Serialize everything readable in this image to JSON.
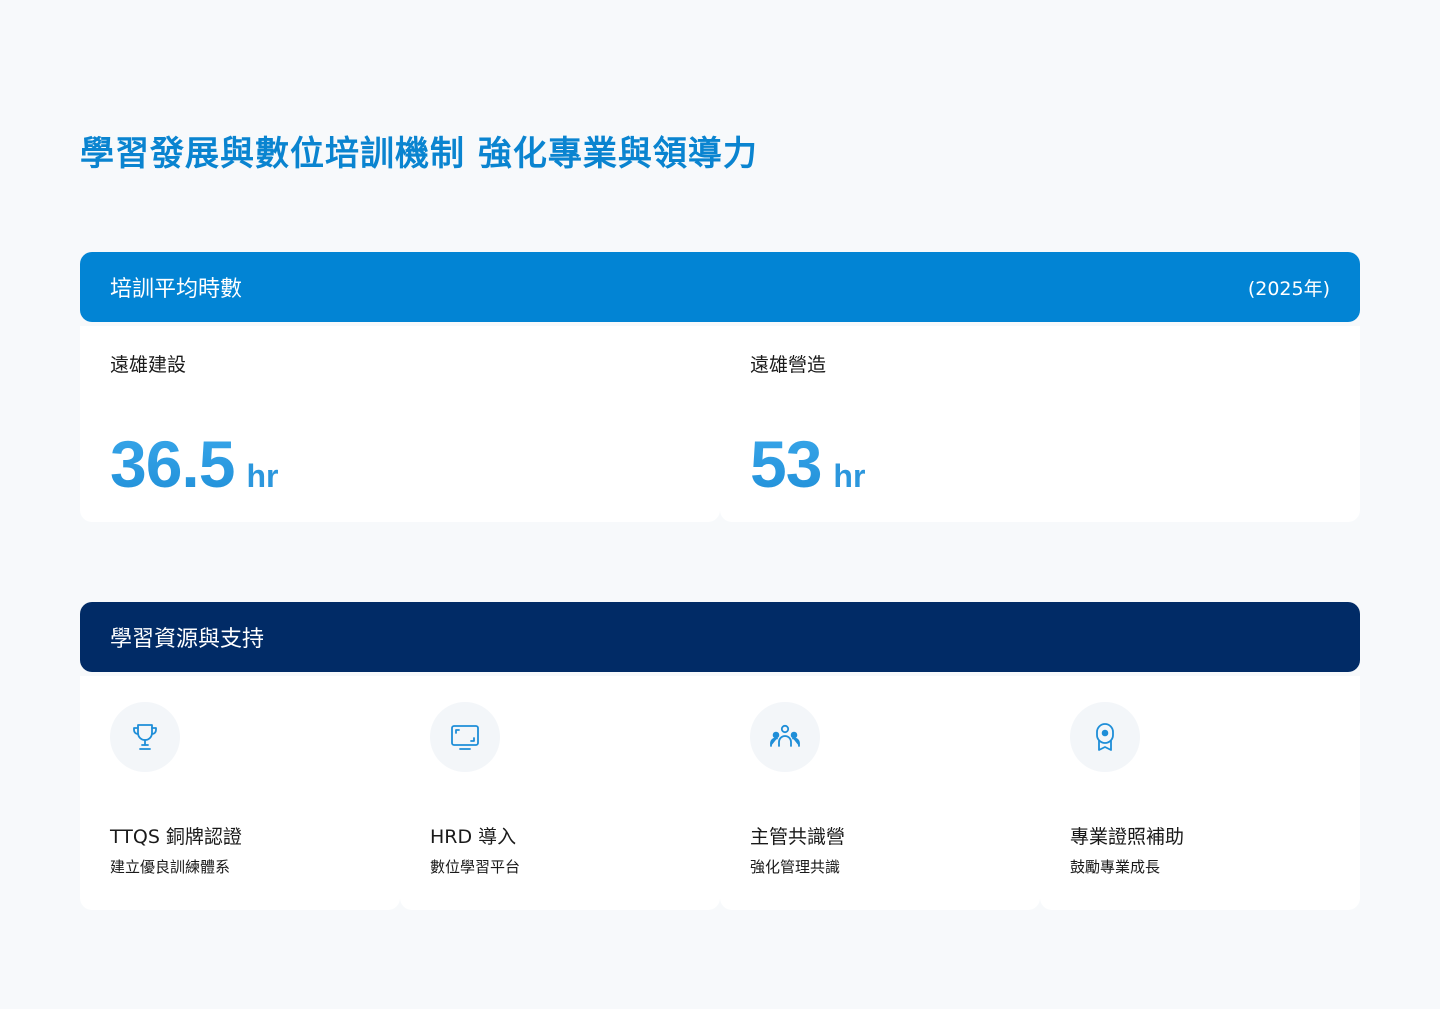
{
  "page_title": "學習發展與數位培訓機制 強化專業與領導力",
  "training": {
    "header_title": "培訓平均時數",
    "year": "(2025年)",
    "stats": [
      {
        "label": "遠雄建設",
        "value": "36.5",
        "unit": "hr"
      },
      {
        "label": "遠雄營造",
        "value": "53",
        "unit": "hr"
      }
    ]
  },
  "resources": {
    "header_title": "學習資源與支持",
    "items": [
      {
        "icon": "trophy-icon",
        "title": "TTQS 銅牌認證",
        "subtitle": "建立優良訓練體系"
      },
      {
        "icon": "monitor-icon",
        "title": "HRD 導入",
        "subtitle": "數位學習平台"
      },
      {
        "icon": "group-icon",
        "title": "主管共識營",
        "subtitle": "強化管理共識"
      },
      {
        "icon": "certificate-icon",
        "title": "專業證照補助",
        "subtitle": "鼓勵專業成長"
      }
    ]
  },
  "colors": {
    "accent": "#0284d4",
    "navy": "#012b66",
    "title": "#0a84d0",
    "stat": "#2c97dd"
  }
}
